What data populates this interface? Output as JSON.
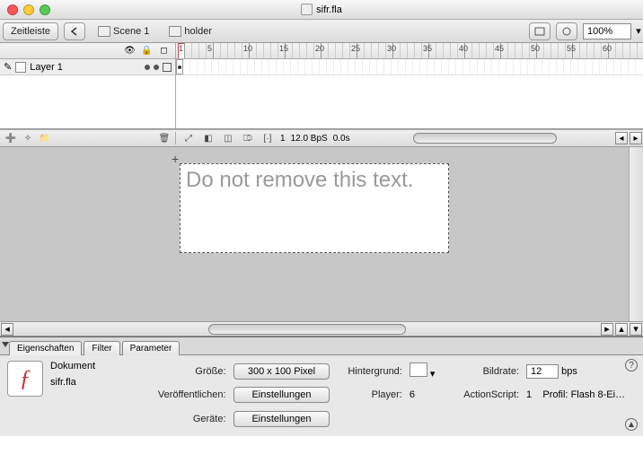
{
  "title": "sifr.fla",
  "toolbar": {
    "timeline_label": "Zeitleiste",
    "scene_label": "Scene 1",
    "holder_label": "holder",
    "zoom": "100%"
  },
  "timeline": {
    "layer_name": "Layer 1",
    "ticks": [
      "1",
      "5",
      "10",
      "15",
      "20",
      "25",
      "30",
      "35",
      "40",
      "45",
      "50",
      "55",
      "60"
    ],
    "current_frame": "1",
    "fps": "12.0 BpS",
    "time": "0.0s"
  },
  "stage": {
    "text": "Do not remove this text."
  },
  "props": {
    "tabs": {
      "t1": "Eigenschaften",
      "t2": "Filter",
      "t3": "Parameter"
    },
    "doc_label": "Dokument",
    "filename": "sifr.fla",
    "size_label": "Größe:",
    "size_btn": "300 x 100 Pixel",
    "bg_label": "Hintergrund:",
    "rate_label": "Bildrate:",
    "rate_val": "12",
    "rate_unit": "bps",
    "publish_label": "Veröffentlichen:",
    "settings_btn": "Einstellungen",
    "player_label": "Player:",
    "player_val": "6",
    "as_label": "ActionScript:",
    "as_val": "1",
    "profile_label": "Profil:",
    "profile_val": "Flash 8-Ei…",
    "devices_label": "Geräte:"
  }
}
